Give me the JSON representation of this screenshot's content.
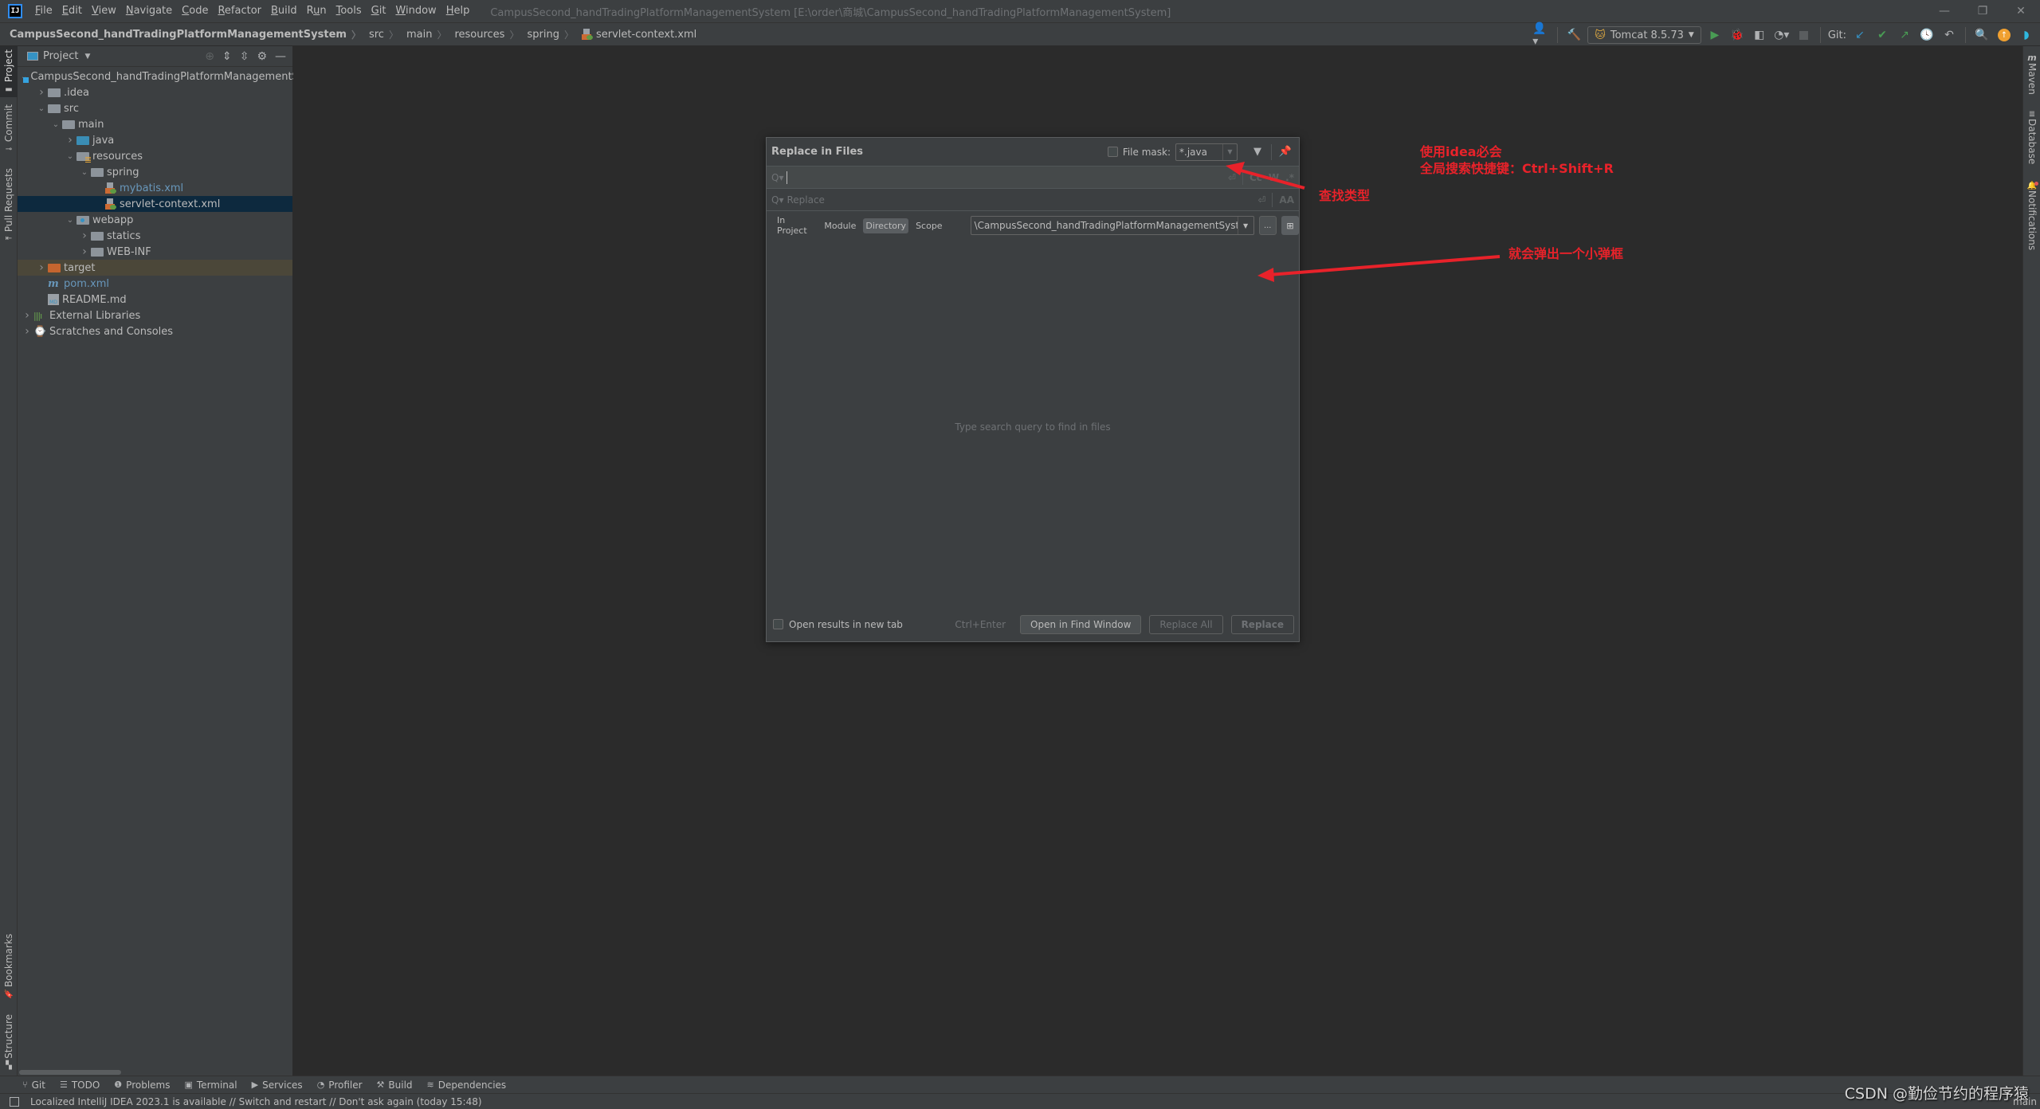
{
  "menubar": {
    "logo": "IJ",
    "items": [
      {
        "label": "File",
        "mnemonic": "F",
        "rest": "ile"
      },
      {
        "label": "Edit",
        "mnemonic": "E",
        "rest": "dit"
      },
      {
        "label": "View",
        "mnemonic": "V",
        "rest": "iew"
      },
      {
        "label": "Navigate",
        "mnemonic": "N",
        "rest": "avigate"
      },
      {
        "label": "Code",
        "mnemonic": "C",
        "rest": "ode"
      },
      {
        "label": "Refactor",
        "mnemonic": "R",
        "rest": "efactor"
      },
      {
        "label": "Build",
        "mnemonic": "B",
        "rest": "uild"
      },
      {
        "label": "Run",
        "pre": "R",
        "mnemonic": "u",
        "rest": "n"
      },
      {
        "label": "Tools",
        "mnemonic": "T",
        "rest": "ools"
      },
      {
        "label": "Git",
        "mnemonic": "G",
        "rest": "it"
      },
      {
        "label": "Window",
        "mnemonic": "W",
        "rest": "indow"
      },
      {
        "label": "Help",
        "mnemonic": "H",
        "rest": "elp"
      }
    ],
    "window_title": "CampusSecond_handTradingPlatformManagementSystem [E:\\order\\商城\\CampusSecond_handTradingPlatformManagementSystem]",
    "window_controls": {
      "minimize": "—",
      "restore": "❐",
      "close": "✕"
    }
  },
  "navbar": {
    "breadcrumbs": [
      "CampusSecond_handTradingPlatformManagementSystem",
      "src",
      "main",
      "resources",
      "spring",
      "servlet-context.xml"
    ],
    "run_config": "Tomcat 8.5.73",
    "git_label": "Git:"
  },
  "left_stripe": {
    "top_tabs": [
      "Project",
      "Commit",
      "Pull Requests"
    ],
    "bottom_tabs": [
      "Bookmarks",
      "Structure"
    ]
  },
  "right_stripe": {
    "tabs": [
      "Maven",
      "Database",
      "Notifications"
    ]
  },
  "project_panel": {
    "title": "Project",
    "tree": [
      {
        "label": "CampusSecond_handTradingPlatformManagementSystem",
        "depth": 0,
        "expanded": true,
        "icon": "project"
      },
      {
        "label": ".idea",
        "depth": 1,
        "expanded": false,
        "icon": "folder"
      },
      {
        "label": "src",
        "depth": 1,
        "expanded": true,
        "icon": "folder"
      },
      {
        "label": "main",
        "depth": 2,
        "expanded": true,
        "icon": "folder"
      },
      {
        "label": "java",
        "depth": 3,
        "expanded": false,
        "icon": "source-folder"
      },
      {
        "label": "resources",
        "depth": 3,
        "expanded": true,
        "icon": "resources-folder"
      },
      {
        "label": "spring",
        "depth": 4,
        "expanded": true,
        "icon": "folder"
      },
      {
        "label": "mybatis.xml",
        "depth": 5,
        "icon": "spring-xml",
        "modified": true
      },
      {
        "label": "servlet-context.xml",
        "depth": 5,
        "icon": "spring-xml",
        "selected": true
      },
      {
        "label": "webapp",
        "depth": 3,
        "expanded": true,
        "icon": "web-folder"
      },
      {
        "label": "statics",
        "depth": 4,
        "expanded": false,
        "icon": "folder"
      },
      {
        "label": "WEB-INF",
        "depth": 4,
        "expanded": false,
        "icon": "folder"
      },
      {
        "label": "target",
        "depth": 1,
        "expanded": false,
        "icon": "excluded-folder",
        "excluded": true
      },
      {
        "label": "pom.xml",
        "depth": 1,
        "icon": "maven",
        "modified": true
      },
      {
        "label": "README.md",
        "depth": 1,
        "icon": "markdown"
      },
      {
        "label": "External Libraries",
        "depth": 0,
        "expanded": false,
        "icon": "libraries"
      },
      {
        "label": "Scratches and Consoles",
        "depth": 0,
        "expanded": false,
        "icon": "scratches"
      }
    ]
  },
  "dialog": {
    "title": "Replace in Files",
    "file_mask_label": "File mask:",
    "file_mask_checked": false,
    "file_mask_value": "*.java",
    "search_value": "",
    "search_options": [
      "Cc",
      "W",
      ".*"
    ],
    "replace_placeholder": "Replace",
    "scope_tabs": [
      "In Project",
      "Module",
      "Directory",
      "Scope"
    ],
    "active_scope": "Directory",
    "directory_value": "\\CampusSecond_handTradingPlatformManagementSyst",
    "browse_label": "...",
    "empty_hint": "Type search query to find in files",
    "open_new_tab_label": "Open results in new tab",
    "open_new_tab_checked": false,
    "shortcut_hint": "Ctrl+Enter",
    "buttons": {
      "open_in_find": "Open in Find Window",
      "replace_all": "Replace All",
      "replace": "Replace"
    }
  },
  "annotations": {
    "title_line1": "使用idea必会",
    "title_line2": "全局搜索快捷键：Ctrl+Shift+R",
    "file_type": "查找类型",
    "popup": "就会弹出一个小弹框",
    "color": "#e8222a"
  },
  "bottom_tools": [
    {
      "label": "Git",
      "icon": "git-branch-icon",
      "glyph": "⑂"
    },
    {
      "label": "TODO",
      "icon": "todo-icon",
      "glyph": "☰"
    },
    {
      "label": "Problems",
      "icon": "problems-icon",
      "glyph": "❶"
    },
    {
      "label": "Terminal",
      "icon": "terminal-icon",
      "glyph": "▣"
    },
    {
      "label": "Services",
      "icon": "services-icon",
      "glyph": "▶"
    },
    {
      "label": "Profiler",
      "icon": "profiler-icon",
      "glyph": "◔"
    },
    {
      "label": "Build",
      "icon": "build-hammer-icon",
      "glyph": "⚒"
    },
    {
      "label": "Dependencies",
      "icon": "dependencies-icon",
      "glyph": "≋"
    }
  ],
  "status_bar": {
    "message": "Localized IntelliJ IDEA 2023.1 is available // Switch and restart // Don't ask again (today 15:48)",
    "branch": "main"
  },
  "watermark": "CSDN @勤俭节约的程序猿"
}
